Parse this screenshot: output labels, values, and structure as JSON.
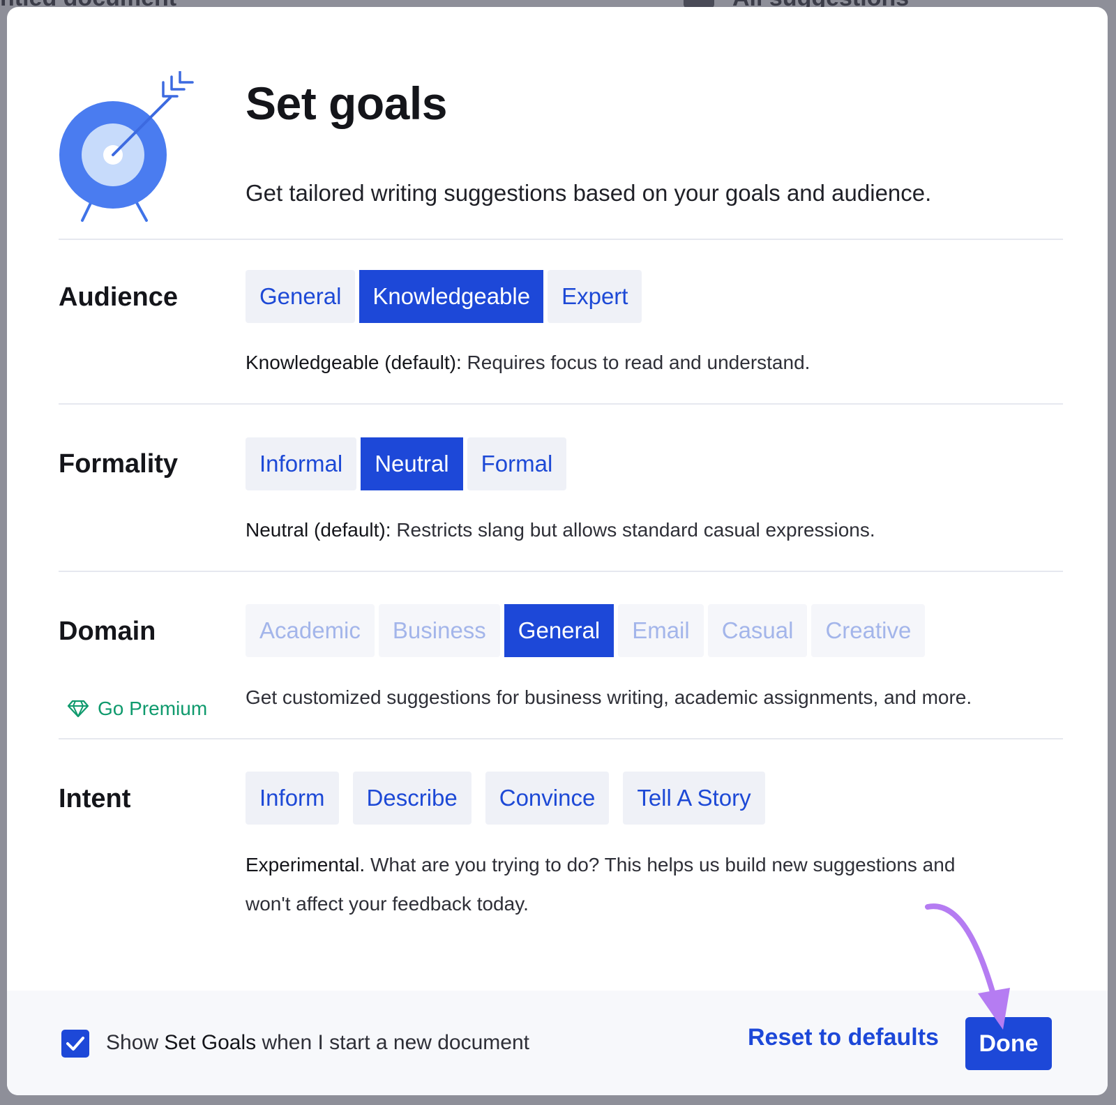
{
  "background": {
    "left_fragment": "ntled document",
    "right_fragment": "All suggestions"
  },
  "dialog": {
    "title": "Set goals",
    "subtitle": "Get tailored writing suggestions based on your goals and audience.",
    "hero_icon": "target-with-arrow-icon"
  },
  "colors": {
    "accent": "#1d48d8",
    "premium": "#0f9a6d",
    "annotation_arrow": "#b57cf2"
  },
  "audience": {
    "label": "Audience",
    "options": [
      "General",
      "Knowledgeable",
      "Expert"
    ],
    "selected": "Knowledgeable",
    "desc_strong": "Knowledgeable (default):",
    "desc": " Requires focus to read and understand."
  },
  "formality": {
    "label": "Formality",
    "options": [
      "Informal",
      "Neutral",
      "Formal"
    ],
    "selected": "Neutral",
    "desc_strong": "Neutral (default):",
    "desc": " Restricts slang but allows standard casual expressions."
  },
  "domain": {
    "label": "Domain",
    "options": [
      "Academic",
      "Business",
      "General",
      "Email",
      "Casual",
      "Creative"
    ],
    "selected": "General",
    "premium_label": "Go Premium",
    "premium_icon": "diamond-icon",
    "desc": "Get customized suggestions for business writing, academic assignments, and more."
  },
  "intent": {
    "label": "Intent",
    "options": [
      "Inform",
      "Describe",
      "Convince",
      "Tell A Story"
    ],
    "desc_strong": "Experimental.",
    "desc": " What are you trying to do? This helps us build new suggestions and",
    "desc_line2": "won't affect your feedback today."
  },
  "footer": {
    "checkbox_checked": true,
    "text_before": "Show ",
    "text_strong": "Set Goals",
    "text_after": " when I start a new document",
    "reset_label": "Reset to defaults",
    "done_label": "Done"
  }
}
